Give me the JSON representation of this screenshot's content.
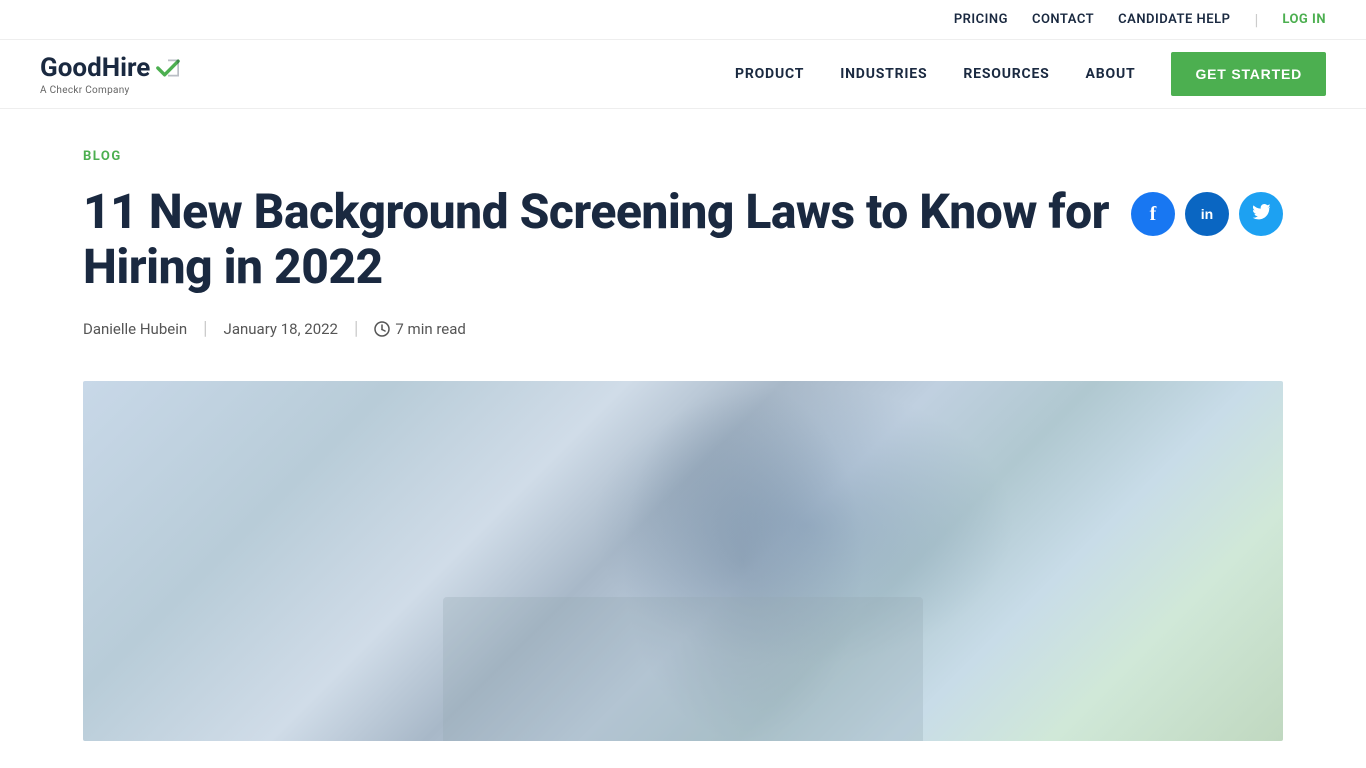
{
  "topbar": {
    "pricing_label": "PRICING",
    "contact_label": "CONTACT",
    "candidate_help_label": "CANDIDATE HELP",
    "divider": "|",
    "login_label": "LOG IN"
  },
  "nav": {
    "logo_name": "GoodHire",
    "logo_icon": "✓",
    "logo_subtitle": "A Checkr Company",
    "product_label": "PRODUCT",
    "industries_label": "INDUSTRIES",
    "resources_label": "RESOURCES",
    "about_label": "ABOUT",
    "get_started_label": "GET STARTED"
  },
  "article": {
    "blog_label": "BLOG",
    "title": "11 New Background Screening Laws to Know for Hiring in 2022",
    "author": "Danielle Hubein",
    "date": "January 18, 2022",
    "read_time": "7 min read"
  },
  "social": {
    "facebook_label": "f",
    "linkedin_label": "in",
    "twitter_label": "t"
  },
  "colors": {
    "green": "#4caf50",
    "dark_navy": "#1a2940",
    "facebook_blue": "#1877f2",
    "linkedin_blue": "#0a66c2",
    "twitter_blue": "#1da1f2"
  }
}
